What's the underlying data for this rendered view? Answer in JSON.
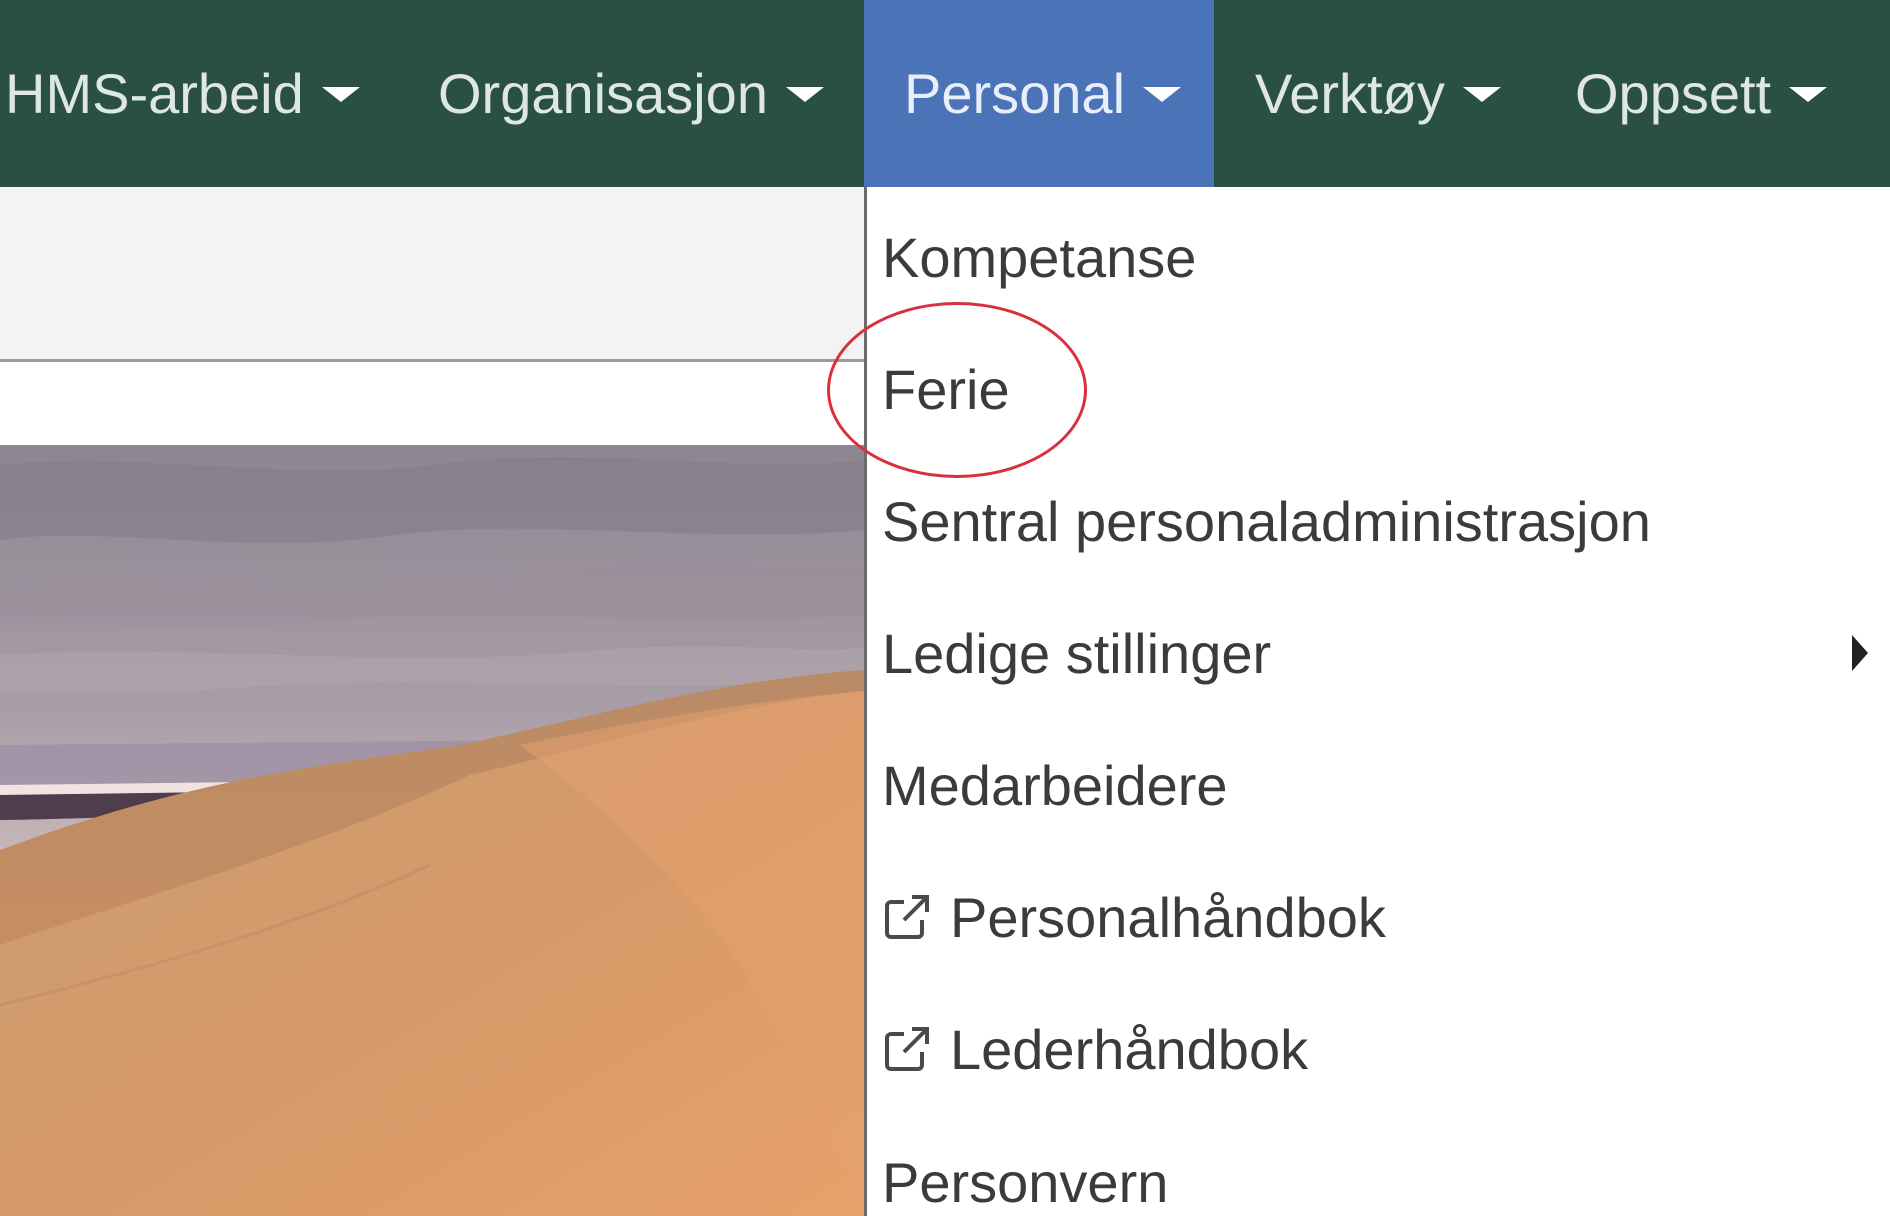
{
  "navbar": {
    "items": [
      {
        "label": "HMS-arbeid",
        "active": false
      },
      {
        "label": "Organisasjon",
        "active": false
      },
      {
        "label": "Personal",
        "active": true
      },
      {
        "label": "Verktøy",
        "active": false
      },
      {
        "label": "Oppsett",
        "active": false
      }
    ],
    "colors": {
      "background": "#2a5045",
      "active": "#4a73b8"
    }
  },
  "dropdown": {
    "items": [
      {
        "label": "Kompetanse",
        "icon": null,
        "has_submenu": false
      },
      {
        "label": "Ferie",
        "icon": null,
        "has_submenu": false,
        "highlighted": true
      },
      {
        "label": "Sentral personaladministrasjon",
        "icon": null,
        "has_submenu": false
      },
      {
        "label": "Ledige stillinger",
        "icon": null,
        "has_submenu": true
      },
      {
        "label": "Medarbeidere",
        "icon": null,
        "has_submenu": false
      },
      {
        "label": "Personalhåndbok",
        "icon": "external-link-icon",
        "has_submenu": false
      },
      {
        "label": "Lederhåndbok",
        "icon": "external-link-icon",
        "has_submenu": false
      },
      {
        "label": "Personvern",
        "icon": null,
        "has_submenu": false
      }
    ]
  },
  "annotation": {
    "color": "#d9303d"
  },
  "background_image": {
    "subject": "desert-sand-dunes"
  }
}
